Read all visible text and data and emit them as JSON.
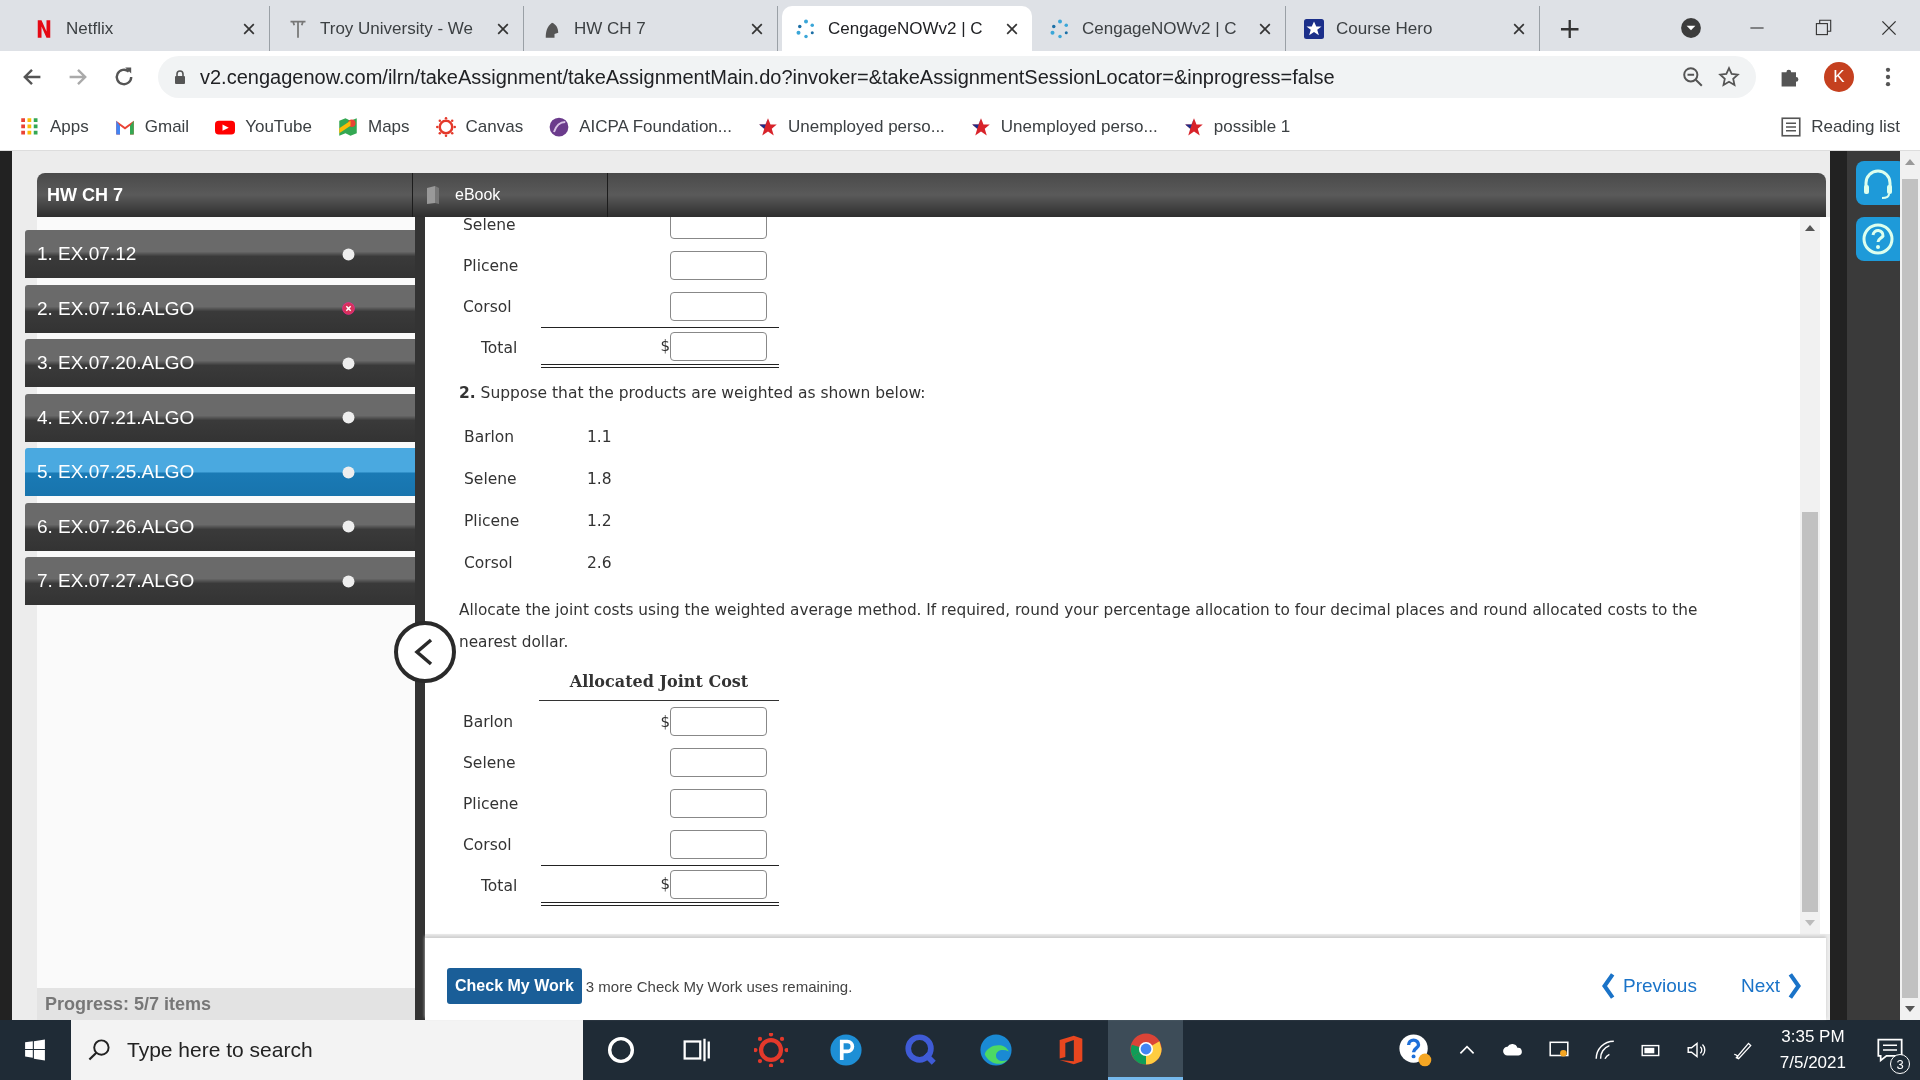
{
  "browser": {
    "tabs": [
      {
        "title": "Netflix",
        "kind": "netflix",
        "selected": false
      },
      {
        "title": "Troy University - We",
        "kind": "troy",
        "selected": false
      },
      {
        "title": "HW CH 7",
        "kind": "trojan",
        "selected": false
      },
      {
        "title": "CengageNOWv2 | C",
        "kind": "cengage",
        "selected": true
      },
      {
        "title": "CengageNOWv2 | C",
        "kind": "cengage",
        "selected": false
      },
      {
        "title": "Course Hero",
        "kind": "star",
        "selected": false
      }
    ],
    "new_tab": "+",
    "address": "v2.cengagenow.com/ilrn/takeAssignment/takeAssignmentMain.do?invoker=&takeAssignmentSessionLocator=&inprogress=false",
    "profile_initial": "K",
    "bookmarks": [
      {
        "label": "Apps",
        "kind": "apps"
      },
      {
        "label": "Gmail",
        "kind": "gmail"
      },
      {
        "label": "YouTube",
        "kind": "youtube"
      },
      {
        "label": "Maps",
        "kind": "maps"
      },
      {
        "label": "Canvas",
        "kind": "canvas"
      },
      {
        "label": "AICPA Foundation...",
        "kind": "aicpa"
      },
      {
        "label": "Unemployed perso...",
        "kind": "star"
      },
      {
        "label": "Unemployed perso...",
        "kind": "star"
      },
      {
        "label": "possible 1",
        "kind": "star"
      }
    ],
    "reading_list": "Reading list"
  },
  "assignment": {
    "title": "HW CH 7",
    "ebook": "eBook",
    "items": [
      {
        "label": "1. EX.07.12",
        "selected": false,
        "incorrect": false
      },
      {
        "label": "2. EX.07.16.ALGO",
        "selected": false,
        "incorrect": true
      },
      {
        "label": "3. EX.07.20.ALGO",
        "selected": false,
        "incorrect": false
      },
      {
        "label": "4. EX.07.21.ALGO",
        "selected": false,
        "incorrect": false
      },
      {
        "label": "5. EX.07.25.ALGO",
        "selected": true,
        "incorrect": false
      },
      {
        "label": "6. EX.07.26.ALGO",
        "selected": false,
        "incorrect": false
      },
      {
        "label": "7. EX.07.27.ALGO",
        "selected": false,
        "incorrect": false
      }
    ],
    "progress": "Progress:  5/7 items"
  },
  "content": {
    "first_table": {
      "rows": [
        {
          "label": "Selene",
          "currency": null,
          "kind": "item"
        },
        {
          "label": "Plicene",
          "currency": null,
          "kind": "item"
        },
        {
          "label": "Corsol",
          "currency": null,
          "kind": "item"
        },
        {
          "label": "Total",
          "currency": "$",
          "kind": "total"
        }
      ]
    },
    "part_number": "2.",
    "part_text": "Suppose that the products are weighted as shown below:",
    "weights": [
      {
        "product": "Barlon",
        "weight": "1.1"
      },
      {
        "product": "Selene",
        "weight": "1.8"
      },
      {
        "product": "Plicene",
        "weight": "1.2"
      },
      {
        "product": "Corsol",
        "weight": "2.6"
      }
    ],
    "instructions": "Allocate the joint costs using the weighted average method. If required, round your percentage allocation to four decimal places and round allocated costs to the nearest dollar.",
    "allocated_table": {
      "heading": "Allocated Joint Cost",
      "rows": [
        {
          "label": "Barlon",
          "currency": "$",
          "kind": "item"
        },
        {
          "label": "Selene",
          "currency": null,
          "kind": "item"
        },
        {
          "label": "Plicene",
          "currency": null,
          "kind": "item"
        },
        {
          "label": "Corsol",
          "currency": null,
          "kind": "item"
        },
        {
          "label": "Total",
          "currency": "$",
          "kind": "total"
        }
      ]
    }
  },
  "footer": {
    "check_button": "Check My Work",
    "remaining": "3 more Check My Work uses remaining.",
    "previous": "Previous",
    "next": "Next"
  },
  "taskbar": {
    "search_placeholder": "Type here to search",
    "apps": [
      {
        "kind": "cortana",
        "selected": false
      },
      {
        "kind": "taskview",
        "selected": false
      },
      {
        "kind": "canvas",
        "selected": false
      },
      {
        "kind": "p",
        "selected": false
      },
      {
        "kind": "q",
        "selected": false
      },
      {
        "kind": "edge",
        "selected": false
      },
      {
        "kind": "office",
        "selected": false
      },
      {
        "kind": "chrome",
        "selected": true
      }
    ],
    "time": "3:35 PM",
    "date": "7/5/2021",
    "notifications": "3"
  }
}
